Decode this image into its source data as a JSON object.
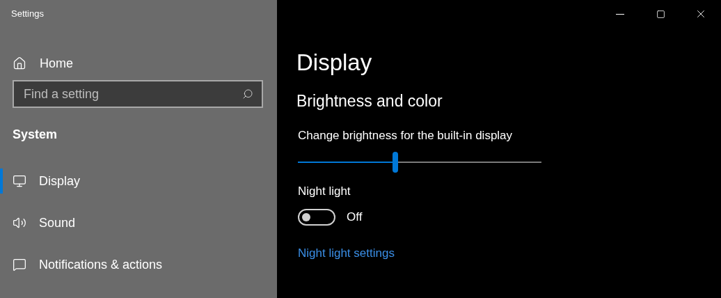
{
  "window": {
    "title": "Settings"
  },
  "sidebar": {
    "home": "Home",
    "search": {
      "placeholder": "Find a setting"
    },
    "section": "System",
    "items": [
      {
        "label": "Display",
        "kind": "display",
        "selected": true
      },
      {
        "label": "Sound",
        "kind": "sound",
        "selected": false
      },
      {
        "label": "Notifications & actions",
        "kind": "notifications",
        "selected": false
      }
    ]
  },
  "main": {
    "title": "Display",
    "section": "Brightness and color",
    "brightness": {
      "label": "Change brightness for the built-in display",
      "level": 0.4
    },
    "night_light": {
      "label": "Night light",
      "on": false,
      "state": "Off"
    },
    "link": "Night light settings"
  }
}
